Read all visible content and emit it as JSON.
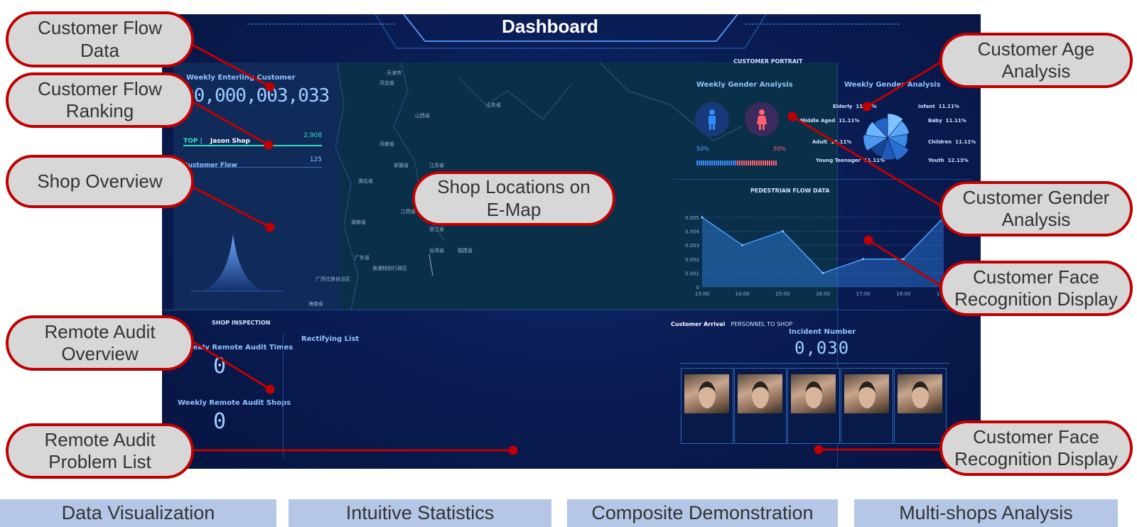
{
  "dashboard": {
    "title": "Dashboard",
    "weekly_entering_label": "Weekly Enterling Customer",
    "weekly_entering_value": "00,000,003,033",
    "top_label": "TOP |",
    "top_shop": "Jason Shop",
    "top_value": "2,908",
    "customer_flow_label": "Customer Flow",
    "customer_flow_value": "125",
    "customer_portrait": "CUSTOMER PORTRAIT",
    "weekly_gender_label_left": "Weekly Gender Analysis",
    "weekly_gender_label_right": "Weekly Gender Analysis",
    "male_pct": "50%",
    "female_pct": "50%",
    "age_groups": [
      {
        "name": "Elderly",
        "pct": "11.11%"
      },
      {
        "name": "Infant",
        "pct": "11.11%"
      },
      {
        "name": "Middle Aged",
        "pct": "11.11%"
      },
      {
        "name": "Baby",
        "pct": "11.11%"
      },
      {
        "name": "Adult",
        "pct": "11.11%"
      },
      {
        "name": "Children",
        "pct": "11.11%"
      },
      {
        "name": "Young Teenager",
        "pct": "11.11%"
      },
      {
        "name": "Youth",
        "pct": "12.13%"
      }
    ],
    "pedestrian_title": "PEDESTRIAN FLOW DATA",
    "shop_inspection": "SHOP INSPECTION",
    "weekly_audit_times_label": "Weekly Remote Audit Times",
    "weekly_audit_times_value": "0",
    "weekly_audit_shops_label": "Weekly Remote Audit Shops",
    "weekly_audit_shops_value": "0",
    "rectifying_list": "Rectifying List",
    "customer_arrival_label": "Customer Arrival",
    "personnel_label": "PERSONNEL TO SHOP",
    "incident_label": "Incident Number",
    "incident_value": "0,030",
    "face_count": 5,
    "map_labels": [
      "天津市",
      "河北省",
      "山西省",
      "山东省",
      "河南省",
      "安徽省",
      "江苏省",
      "湖北省",
      "江西省",
      "浙江省",
      "湖南省",
      "福建省",
      "广东省",
      "台湾省",
      "香港特别行政区",
      "广西壮族自治区",
      "海南省"
    ]
  },
  "chart_data": {
    "type": "area",
    "title": "PEDESTRIAN FLOW DATA",
    "x": [
      "13:00",
      "14:00",
      "15:00",
      "16:00",
      "17:00",
      "18:00",
      "19:00"
    ],
    "values": [
      0.005,
      0.003,
      0.004,
      0.001,
      0.002,
      0.002,
      0.005
    ],
    "yticks": [
      "0",
      "0.001",
      "0.002",
      "0.003",
      "0.004",
      "0.005"
    ],
    "ylim": [
      0,
      0.005
    ],
    "color": "#2f7fe0"
  },
  "pie_data": {
    "type": "pie",
    "values": [
      11.11,
      11.11,
      11.11,
      11.11,
      11.11,
      11.11,
      11.11,
      11.11,
      12.13
    ],
    "colors": [
      "#7ec3ff",
      "#5aa8f5",
      "#3a8ae6",
      "#2a6fd0",
      "#1f58b5",
      "#174596",
      "#4a98ee",
      "#6bb6ff",
      "#2563c2"
    ]
  },
  "callouts": {
    "customer_flow_data": "Customer Flow Data",
    "customer_flow_ranking": "Customer Flow Ranking",
    "shop_overview": "Shop Overview",
    "shop_locations": "Shop Locations on E-Map",
    "remote_audit_overview": "Remote Audit Overview",
    "remote_audit_problem_list": "Remote Audit Problem List",
    "customer_age_analysis": "Customer Age Analysis",
    "customer_gender_analysis": "Customer Gender Analysis",
    "customer_face_recognition_1": "Customer Face Recognition Display",
    "customer_face_recognition_2": "Customer Face Recognition Display"
  },
  "footer": [
    "Data Visualization",
    "Intuitive Statistics",
    "Composite Demonstration",
    "Multi-shops Analysis"
  ],
  "colors": {
    "callout_border": "#c00000",
    "callout_fill": "#d7d7d7",
    "footer_fill": "#b4c7e7"
  }
}
